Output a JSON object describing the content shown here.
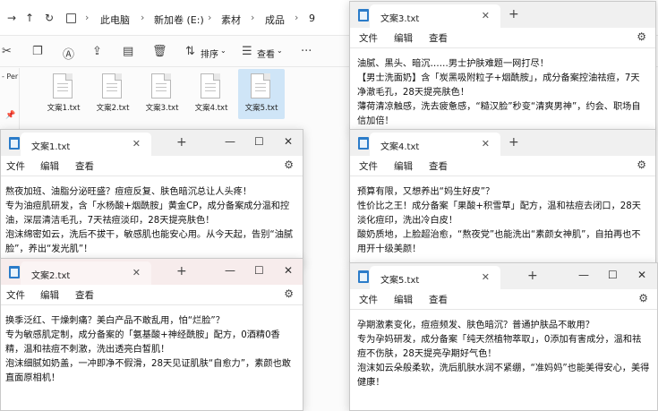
{
  "explorer": {
    "breadcrumb": [
      "此电脑",
      "新加卷 (E:)",
      "素材",
      "成品",
      "9"
    ],
    "toolbar": {
      "sort_label": "排序",
      "view_label": "查看"
    },
    "left_nav_label": "- Per",
    "files": [
      "文案1.txt",
      "文案2.txt",
      "文案3.txt",
      "文案4.txt",
      "文案5.txt"
    ]
  },
  "notepad_menu": {
    "file": "文件",
    "edit": "编辑",
    "view": "查看"
  },
  "windows": {
    "w3": {
      "title": "文案3.txt",
      "lines": [
        "油腻、黑头、暗沉……男士护肤难题一网打尽！",
        "【男士洗面奶】含「炭黑吸附粒子+烟酰胺」，成分备案控油祛痘，7天净澈毛孔，28天提亮肤色！",
        "薄荷清凉触感，洗去疲惫感，“糙汉脸”秒变“清爽男神”，约会、职场自信加倍！"
      ]
    },
    "w1": {
      "title": "文案1.txt",
      "lines": [
        "熬夜加班、油脂分泌旺盛？痘痘反复、肤色暗沉总让人头疼！",
        "专为油痘肌研发，含「水杨酸+烟酰胺」黄金CP，成分备案成分温和控油，深层清洁毛孔，7天祛痘淡印，28天提亮肤色！",
        "泡沫绵密如云，洗后不拔干，敏感肌也能安心用。从今天起，告别“油腻脸”，养出“发光肌”！"
      ]
    },
    "w4": {
      "title": "文案4.txt",
      "lines": [
        "预算有限，又想养出“妈生好皮”？",
        "性价比之王！成分备案「果酸+积雪草」配方，温和祛痘去闭口，28天淡化痘印，洗出冷白皮！",
        "酸奶质地，上脸超治愈，“熬夜党”也能洗出“素颜女神肌”，自拍再也不用开十级美颜！"
      ]
    },
    "w2": {
      "title": "文案2.txt",
      "lines": [
        "换季泛红、干燥刺痛？美白产品不敢乱用，怕“烂脸”？",
        "专为敏感肌定制，成分备案的「氨基酸+神经酰胺」配方，0酒精0香精，温和祛痘不刺激，洗出透亮白皙肌！",
        "泡沫细腻如奶盖，一冲即净不假滑，28天见证肌肤“自愈力”，素颜也敢直面原相机！"
      ]
    },
    "w5": {
      "title": "文案5.txt",
      "lines": [
        "孕期激素变化，痘痘频发、肤色暗沉？普通护肤品不敢用？",
        "专为孕妈研发，成分备案「纯天然植物萃取」，0添加有害成分，温和祛痘不伤肤，28天提亮孕期好气色！",
        "泡沫如云朵般柔软，洗后肌肤水润不紧绷，“准妈妈”也能美得安心，美得健康！"
      ]
    }
  }
}
